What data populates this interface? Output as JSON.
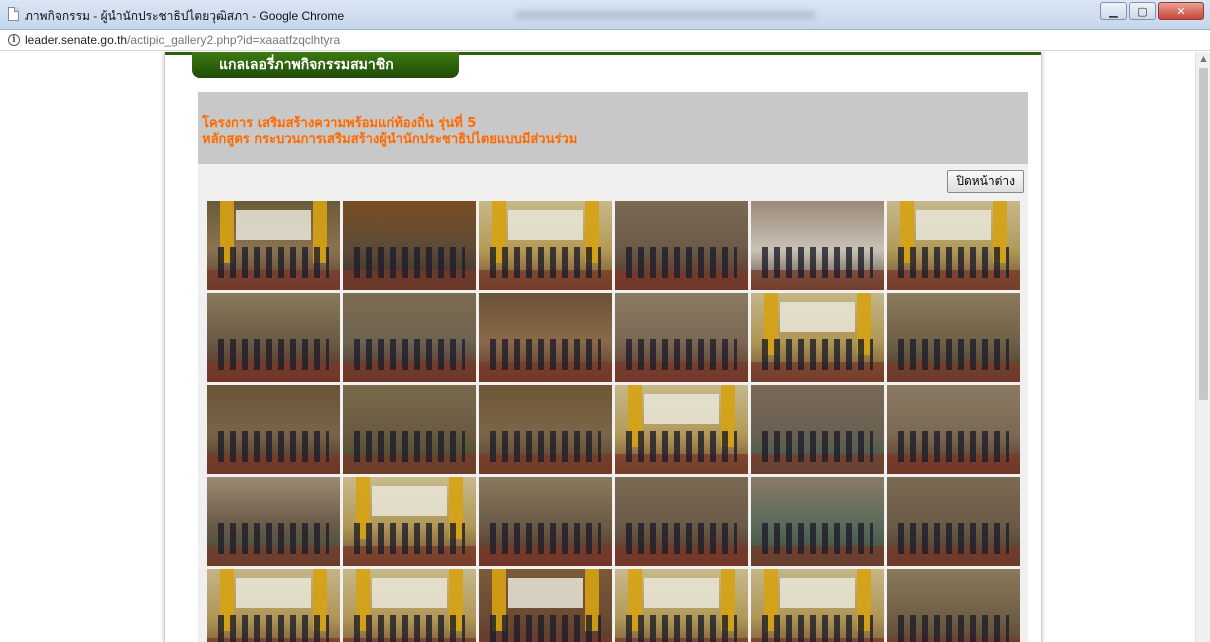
{
  "window": {
    "title": "ภาพกิจกรรม - ผู้นำนักประชาธิปไตยวุฒิสภา - Google Chrome",
    "minimize_glyph": "▁",
    "maximize_glyph": "▢",
    "close_glyph": "✕"
  },
  "address_bar": {
    "url_host": "leader.senate.go.th",
    "url_path": "/actipic_gallery2.php?id=xaaatfzqclhtyra"
  },
  "page": {
    "gallery_tab_label": "แกลเลอรี่ภาพกิจกรรมสมาชิก",
    "heading_line1": "โครงการ เสริมสร้างความพร้อมแก่ท้องถิ่น รุ่นที่ 5",
    "heading_line2": "หลักสูตร กระบวนการเสริมสร้างผู้นำนักประชาธิปไตยแบบมีส่วนร่วม",
    "close_window_button": "ปิดหน้าต่าง"
  },
  "gallery": {
    "photos": [
      {
        "scene": "stage",
        "c1": "#6b5a3a",
        "c2": "#8a7350",
        "c3": "#5a3a2e"
      },
      {
        "scene": "speaker",
        "c1": "#7a4f22",
        "c2": "#5c4a38",
        "c3": "#3c2e26"
      },
      {
        "scene": "stage",
        "c1": "#c8b98a",
        "c2": "#b59a55",
        "c3": "#6a4a2e"
      },
      {
        "scene": "hall",
        "c1": "#7a6a52",
        "c2": "#6b5a48",
        "c3": "#5a2f24"
      },
      {
        "scene": "board",
        "c1": "#9a8a78",
        "c2": "#c9c2b6",
        "c3": "#5a4a3a"
      },
      {
        "scene": "stage",
        "c1": "#c7b98d",
        "c2": "#b09a5a",
        "c3": "#6c4a30"
      },
      {
        "scene": "hall",
        "c1": "#8a7a5c",
        "c2": "#6a5a44",
        "c3": "#5a2e22"
      },
      {
        "scene": "hall",
        "c1": "#7c6c50",
        "c2": "#6e6250",
        "c3": "#4e2e22"
      },
      {
        "scene": "hall",
        "c1": "#6a5238",
        "c2": "#8a6a4a",
        "c3": "#5a3428"
      },
      {
        "scene": "hall",
        "c1": "#8a7a62",
        "c2": "#7a6854",
        "c3": "#5e3226"
      },
      {
        "scene": "stage",
        "c1": "#c4b688",
        "c2": "#ae9654",
        "c3": "#6a4c30"
      },
      {
        "scene": "hall",
        "c1": "#8c7a5a",
        "c2": "#6e6048",
        "c3": "#4a3a2a"
      },
      {
        "scene": "hall",
        "c1": "#6a5438",
        "c2": "#7a6448",
        "c3": "#4a3024"
      },
      {
        "scene": "hall",
        "c1": "#7a6a4c",
        "c2": "#6a5a40",
        "c3": "#3e4a2a"
      },
      {
        "scene": "speaker",
        "c1": "#6e5636",
        "c2": "#7a6648",
        "c3": "#5a3a28"
      },
      {
        "scene": "stage",
        "c1": "#c6b88a",
        "c2": "#b29a58",
        "c3": "#6a4a30"
      },
      {
        "scene": "hall",
        "c1": "#7a6a56",
        "c2": "#6a6050",
        "c3": "#3a5a4a"
      },
      {
        "scene": "hall",
        "c1": "#8a7a62",
        "c2": "#7a6a54",
        "c3": "#5a3226"
      },
      {
        "scene": "hall",
        "c1": "#9a8a72",
        "c2": "#6a5a48",
        "c3": "#3a4a3a"
      },
      {
        "scene": "stage",
        "c1": "#c8ba8c",
        "c2": "#b09858",
        "c3": "#6a4a2e"
      },
      {
        "scene": "hall",
        "c1": "#8a7a5e",
        "c2": "#6a5a46",
        "c3": "#5a2e22"
      },
      {
        "scene": "hall",
        "c1": "#7a6a52",
        "c2": "#6a5a48",
        "c3": "#5c3024"
      },
      {
        "scene": "hall",
        "c1": "#8a7a66",
        "c2": "#5a6a5a",
        "c3": "#3a4a3e"
      },
      {
        "scene": "hall",
        "c1": "#7a6a52",
        "c2": "#6a5a46",
        "c3": "#4a3a2e"
      },
      {
        "scene": "stage",
        "c1": "#c4b488",
        "c2": "#b09656",
        "c3": "#6a4a30"
      },
      {
        "scene": "stage",
        "c1": "#c6b88a",
        "c2": "#b29858",
        "c3": "#6c4a30"
      },
      {
        "scene": "stage",
        "c1": "#7a5a38",
        "c2": "#6a4a32",
        "c3": "#5a3226"
      },
      {
        "scene": "stage",
        "c1": "#c8b98c",
        "c2": "#b09a58",
        "c3": "#6a4a2e"
      },
      {
        "scene": "stage",
        "c1": "#c4b688",
        "c2": "#ae9656",
        "c3": "#6a4a30"
      },
      {
        "scene": "hall",
        "c1": "#8a7a5a",
        "c2": "#6e5e46",
        "c3": "#5a3a2a"
      }
    ]
  }
}
